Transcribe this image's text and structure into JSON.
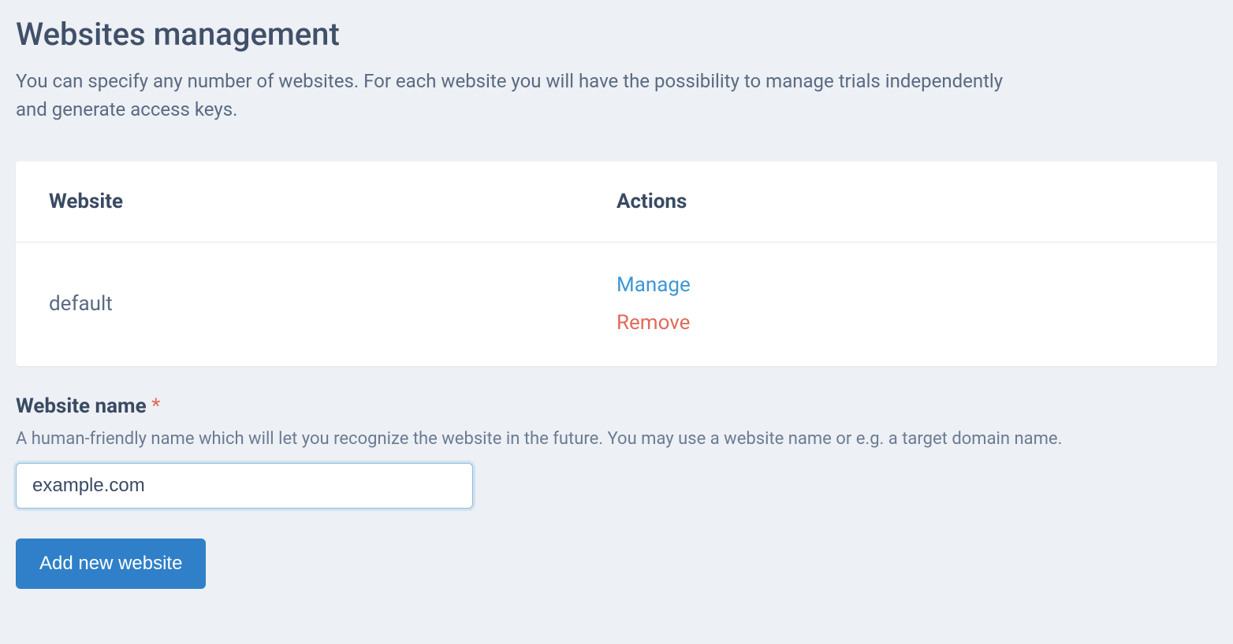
{
  "header": {
    "title": "Websites management",
    "description": "You can specify any number of websites. For each website you will have the possibility to manage trials independently and generate access keys."
  },
  "table": {
    "columns": {
      "website": "Website",
      "actions": "Actions"
    },
    "rows": [
      {
        "name": "default",
        "manage_label": "Manage",
        "remove_label": "Remove"
      }
    ]
  },
  "form": {
    "label": "Website name",
    "required_mark": "*",
    "help_text": "A human-friendly name which will let you recognize the website in the future. You may use a website name or e.g. a target domain name.",
    "input_value": "example.com",
    "submit_label": "Add new website"
  }
}
